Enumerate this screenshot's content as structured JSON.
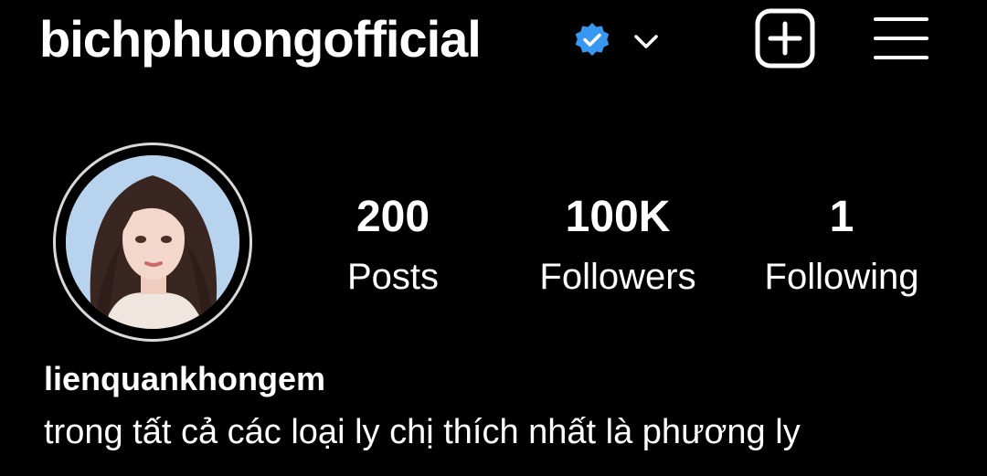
{
  "header": {
    "username": "bichphuongofficial",
    "verified_color": "#3897f0",
    "icons": [
      "verified-badge-icon",
      "chevron-down-icon",
      "new-post-icon",
      "menu-icon"
    ]
  },
  "profile": {
    "avatar": "profile-photo",
    "stats": [
      {
        "value": "200",
        "label": "Posts"
      },
      {
        "value": "100K",
        "label": "Followers"
      },
      {
        "value": "1",
        "label": "Following"
      }
    ],
    "name": "lienquankhongem",
    "bio": "trong tất cả các loại ly chị thích nhất là phương ly"
  },
  "colors": {
    "background": "#000000",
    "text": "#ffffff",
    "avatar_ring": "#d9d9d9"
  }
}
